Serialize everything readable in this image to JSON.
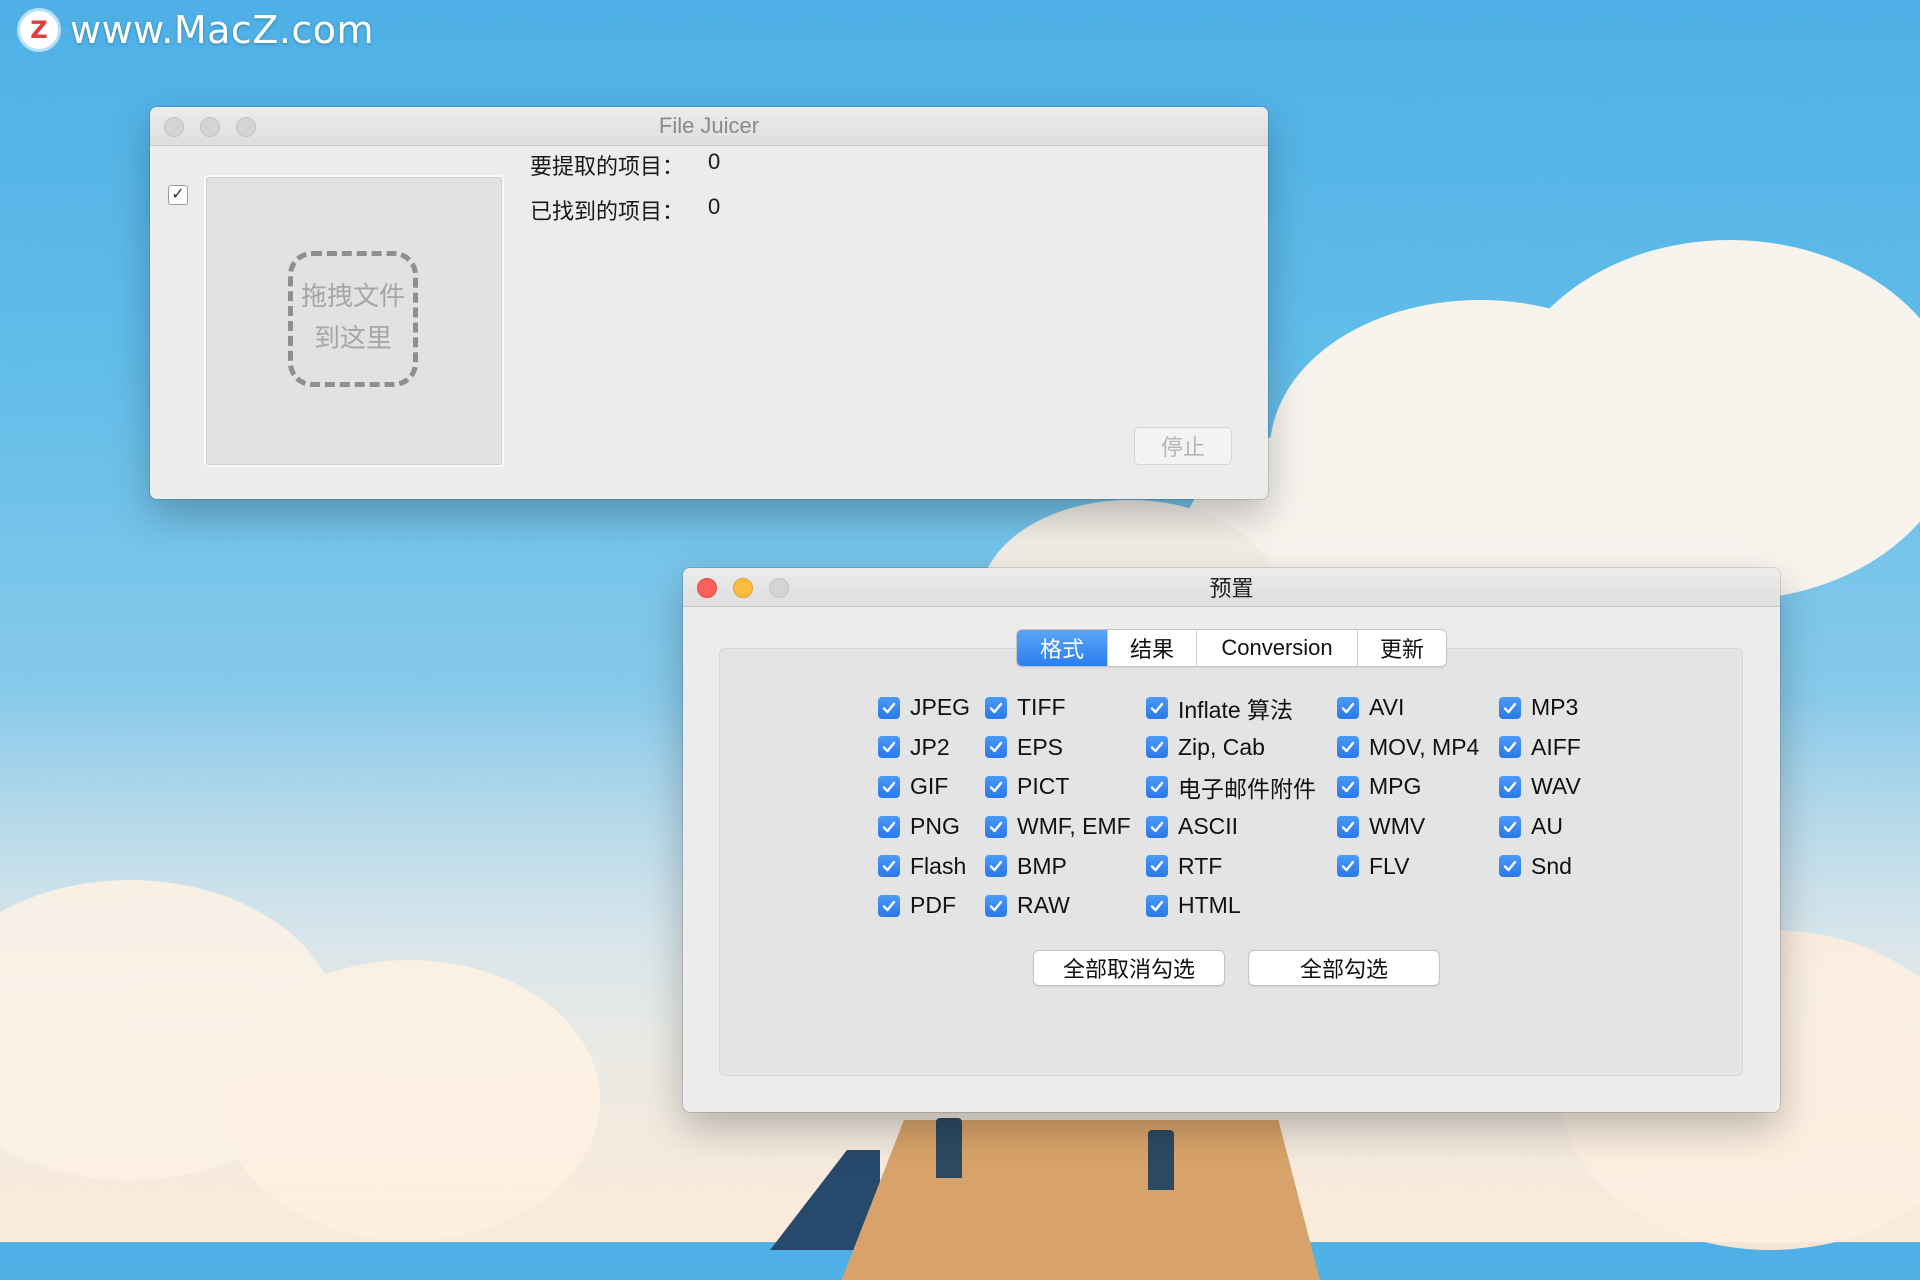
{
  "watermark": {
    "logo_letter": "Z",
    "text": "www.MacZ.com"
  },
  "file_juicer": {
    "title": "File Juicer",
    "checkbox_checked": true,
    "drop_zone_line1": "拖拽文件",
    "drop_zone_line2": "到这里",
    "items_to_extract_label": "要提取的项目：",
    "items_to_extract_value": "0",
    "items_found_label": "已找到的项目：",
    "items_found_value": "0",
    "stop_label": "停止"
  },
  "preferences": {
    "title": "预置",
    "tabs": [
      {
        "label": "格式",
        "active": true
      },
      {
        "label": "结果",
        "active": false
      },
      {
        "label": "Conversion",
        "active": false
      },
      {
        "label": "更新",
        "active": false
      }
    ],
    "formats": {
      "col1": [
        "JPEG",
        "JP2",
        "GIF",
        "PNG",
        "Flash",
        "PDF"
      ],
      "col2": [
        "TIFF",
        "EPS",
        "PICT",
        "WMF, EMF",
        "BMP",
        "RAW"
      ],
      "col3": [
        "Inflate 算法",
        "Zip, Cab",
        "电子邮件附件",
        "ASCII",
        "RTF",
        "HTML"
      ],
      "col4": [
        "AVI",
        "MOV, MP4",
        "MPG",
        "WMV",
        "FLV"
      ],
      "col5": [
        "MP3",
        "AIFF",
        "WAV",
        "AU",
        "Snd"
      ]
    },
    "deselect_all_label": "全部取消勾选",
    "select_all_label": "全部勾选",
    "accent_color": "#2b7ff0"
  }
}
